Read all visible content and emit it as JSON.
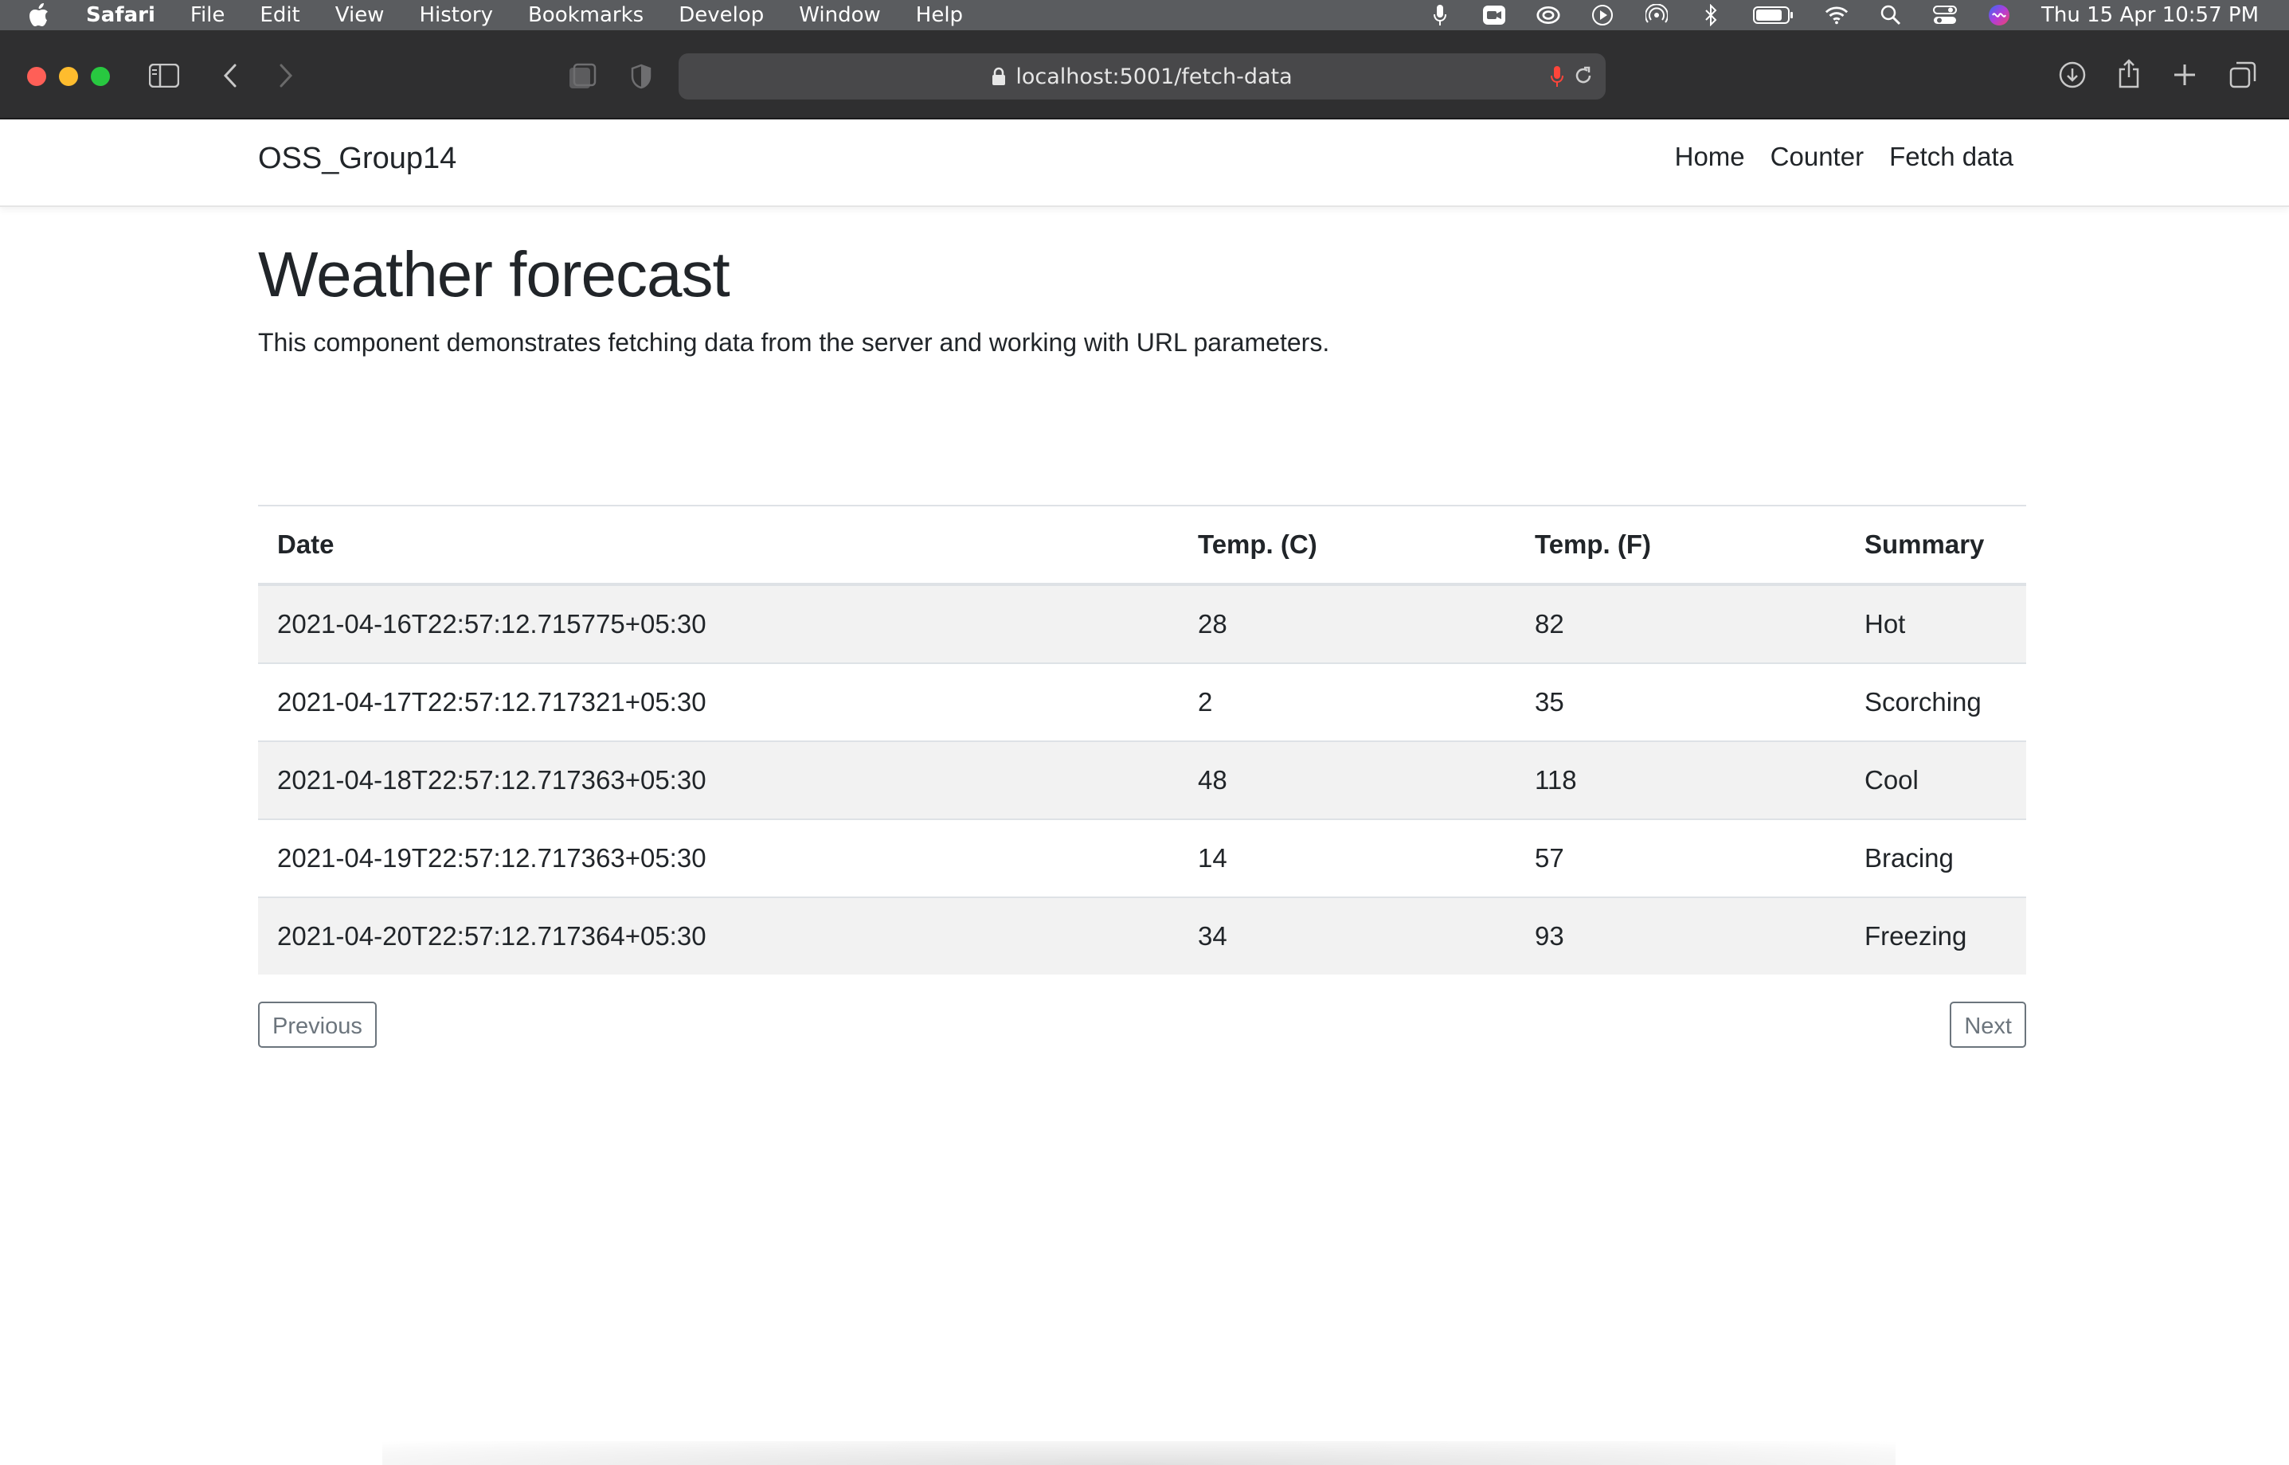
{
  "menubar": {
    "app_name": "Safari",
    "items": [
      "File",
      "Edit",
      "View",
      "History",
      "Bookmarks",
      "Develop",
      "Window",
      "Help"
    ],
    "clock": "Thu 15 Apr  10:57 PM",
    "status_icons": [
      "microphone-icon",
      "facetime-icon",
      "creative-cloud-icon",
      "play-icon",
      "airdrop-icon",
      "bluetooth-icon",
      "battery-icon",
      "wifi-icon",
      "spotlight-search-icon",
      "control-center-icon",
      "siri-icon"
    ]
  },
  "browser": {
    "url": "localhost:5001/fetch-data",
    "colors": {
      "close": "#ff5f57",
      "minimize": "#febc2e",
      "zoom": "#28c840",
      "toolbar": "#2f2f30"
    }
  },
  "navbar": {
    "brand": "OSS_Group14",
    "links": [
      "Home",
      "Counter",
      "Fetch data"
    ]
  },
  "main": {
    "title": "Weather forecast",
    "description": "This component demonstrates fetching data from the server and working with URL parameters.",
    "table": {
      "headers": [
        "Date",
        "Temp. (C)",
        "Temp. (F)",
        "Summary"
      ],
      "rows": [
        [
          "2021-04-16T22:57:12.715775+05:30",
          "28",
          "82",
          "Hot"
        ],
        [
          "2021-04-17T22:57:12.717321+05:30",
          "2",
          "35",
          "Scorching"
        ],
        [
          "2021-04-18T22:57:12.717363+05:30",
          "48",
          "118",
          "Cool"
        ],
        [
          "2021-04-19T22:57:12.717363+05:30",
          "14",
          "57",
          "Bracing"
        ],
        [
          "2021-04-20T22:57:12.717364+05:30",
          "34",
          "93",
          "Freezing"
        ]
      ]
    },
    "previous_label": "Previous",
    "next_label": "Next"
  }
}
